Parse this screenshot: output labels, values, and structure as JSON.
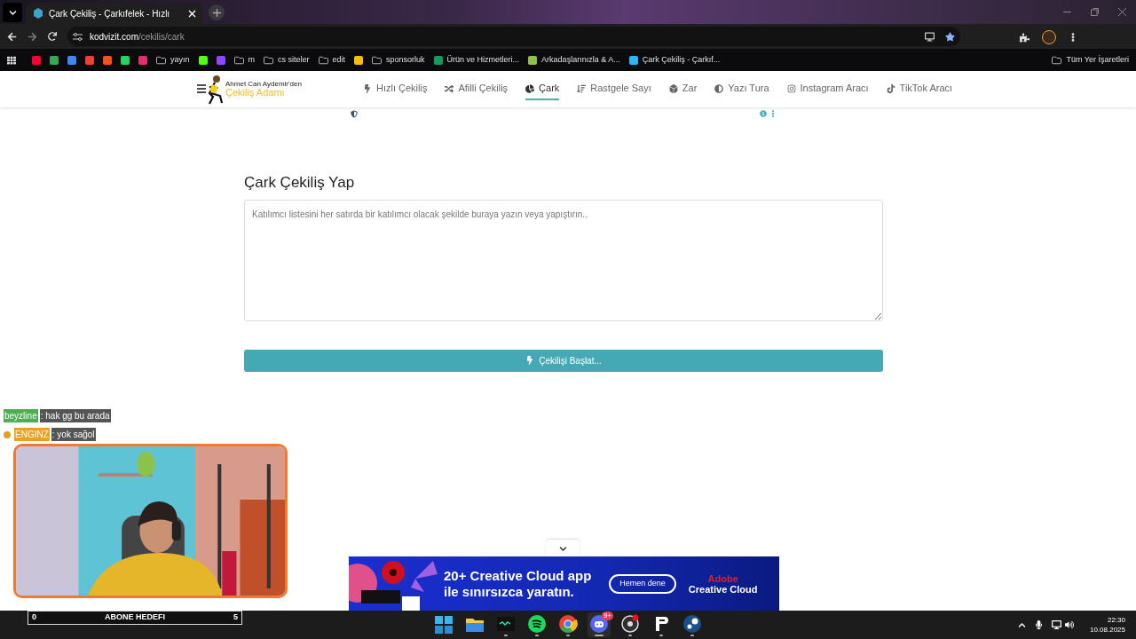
{
  "browser": {
    "tabs": [
      {
        "title": "Çark Çekiliş - Çarkıfelek - Hızlı",
        "selected": true
      }
    ],
    "address": {
      "domain": "kodvizit.com",
      "path": "/cekilis/cark"
    },
    "bookmarks": [
      {
        "kind": "site",
        "color": "#ff0033"
      },
      {
        "kind": "site",
        "color": "#34a853"
      },
      {
        "kind": "site",
        "color": "#4285f4"
      },
      {
        "kind": "site",
        "color": "#ea4335"
      },
      {
        "kind": "site",
        "color": "#f4511e"
      },
      {
        "kind": "site",
        "color": "#25d366"
      },
      {
        "kind": "site",
        "color": "#e1306c"
      },
      {
        "kind": "folder",
        "label": "yayın"
      },
      {
        "kind": "site",
        "color": "#53fc18"
      },
      {
        "kind": "site",
        "color": "#9146ff"
      },
      {
        "kind": "folder",
        "label": "m"
      },
      {
        "kind": "folder",
        "label": "cs siteler"
      },
      {
        "kind": "folder",
        "label": "edit"
      },
      {
        "kind": "site",
        "color": "#fbbc04"
      },
      {
        "kind": "folder",
        "label": "sponsorluk"
      },
      {
        "kind": "site",
        "color": "#0f9d58",
        "label": "Ürün ve Hizmetleri..."
      },
      {
        "kind": "site",
        "color": "#8bc34a",
        "label": "Arkadaşlarınızla & A..."
      },
      {
        "kind": "site",
        "color": "#29b6f6",
        "label": "Çark Çekiliş - Çarkıf..."
      }
    ],
    "all_bookmarks": "Tüm Yer İşaretleri"
  },
  "site": {
    "logo": {
      "tagline": "Ahmet Can Aydemir'den",
      "name": "Çekiliş Adamı"
    },
    "nav": [
      {
        "label": "Hızlı Çekiliş",
        "selected": false
      },
      {
        "label": "Afilli Çekiliş",
        "selected": false
      },
      {
        "label": "Çark",
        "selected": true
      },
      {
        "label": "Rastgele Sayı",
        "selected": false
      },
      {
        "label": "Zar",
        "selected": false
      },
      {
        "label": "Yazı Tura",
        "selected": false
      },
      {
        "label": "Instagram Aracı",
        "selected": false
      },
      {
        "label": "TikTok Aracı",
        "selected": false
      }
    ],
    "heading": "Çark Çekiliş Yap",
    "participants": {
      "placeholder": "Katılımcı listesini her satırda bir katılımcı olacak şekilde buraya yazın veya yapıştırın.."
    },
    "start_button": "Çekilişi Başlat..."
  },
  "ad": {
    "headline": [
      "20+ Creative Cloud app",
      "ile sınırsızca yaratın."
    ],
    "button": "Hemen dene",
    "brand": "Adobe",
    "product": "Creative Cloud"
  },
  "stream": {
    "chat": [
      {
        "user": "beyzline",
        "text": ": hak gg bu arada",
        "color": "#4caf50"
      },
      {
        "user": "ENGINZ",
        "text": ": yok sağol",
        "color": "#f0a020"
      }
    ],
    "goal": {
      "start": "0",
      "label": "ABONE HEDEFI",
      "end": "5"
    }
  },
  "taskbar": {
    "apps": [
      {
        "running": false,
        "active": false
      },
      {
        "running": false,
        "active": false
      },
      {
        "running": true,
        "active": false
      },
      {
        "running": true,
        "active": false
      },
      {
        "running": true,
        "active": false
      },
      {
        "running": true,
        "active": true,
        "badge": "9+"
      },
      {
        "running": true,
        "active": false
      },
      {
        "running": true,
        "active": false
      },
      {
        "running": true,
        "active": false
      }
    ],
    "time": "22:30",
    "date": "10.08.2025"
  }
}
